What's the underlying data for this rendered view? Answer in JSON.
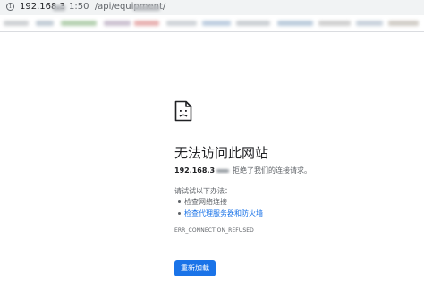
{
  "address_bar": {
    "host": "192.168.3",
    "path": "1:50  /api/equipment/",
    "info_icon": "info-icon"
  },
  "bookmarks_bar": {
    "items_obscured": true
  },
  "error": {
    "icon": "broken-document-icon",
    "title": "无法访问此网站",
    "host": "192.168.3",
    "message": "拒绝了我们的连接请求。",
    "suggestions_intro": "请试试以下办法：",
    "suggestions": [
      {
        "text": "检查网络连接",
        "is_link": false
      },
      {
        "text": "检查代理服务器和防火墙",
        "is_link": true
      }
    ],
    "code": "ERR_CONNECTION_REFUSED",
    "reload_label": "重新加载"
  },
  "colors": {
    "accent": "#1a73e8",
    "text_primary": "#202124",
    "text_secondary": "#5f6368",
    "address_bar_bg": "#f1f3f4"
  }
}
